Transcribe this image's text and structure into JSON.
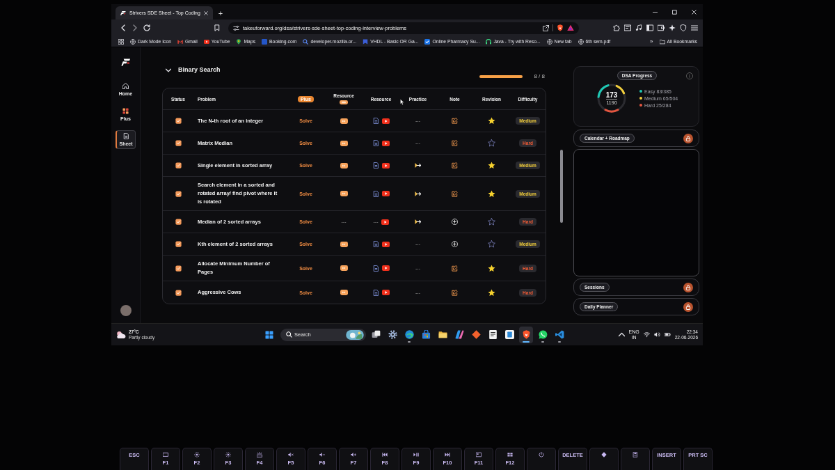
{
  "browser": {
    "tab": {
      "title": "Strivers SDE Sheet - Top Coding"
    },
    "new_tab": "+",
    "url": "takeuforward.org/dsa/strivers-sde-sheet-top-coding-interview-problems",
    "bookmarks": [
      {
        "kind": "globe",
        "label": "Dark Mode Icon"
      },
      {
        "kind": "mail",
        "label": "Gmail"
      },
      {
        "kind": "video",
        "label": "YouTube"
      },
      {
        "kind": "pin",
        "label": "Maps"
      },
      {
        "kind": "square",
        "label": "Booking.com"
      },
      {
        "kind": "magnifier",
        "label": "developer.mozilla.or..."
      },
      {
        "kind": "pentagon",
        "label": "VHDL - Basic OR Ga..."
      },
      {
        "kind": "check",
        "label": "Online Pharmacy Su..."
      },
      {
        "kind": "headphones",
        "label": "Java - Try with Reso..."
      },
      {
        "kind": "globe",
        "label": "New tab"
      },
      {
        "kind": "globe",
        "label": "6th sem.pdf"
      }
    ],
    "more": "»",
    "all_bookmarks": "All Bookmarks"
  },
  "nav": [
    {
      "kind": "home",
      "label": "Home",
      "selected": false
    },
    {
      "kind": "plus",
      "label": "Plus",
      "selected": false
    },
    {
      "kind": "sheet",
      "label": "Sheet",
      "selected": true
    }
  ],
  "section": {
    "title": "Binary Search",
    "expanded": true,
    "level": 1,
    "count": "8 / 8"
  },
  "table": {
    "columns": [
      {
        "kind": "text",
        "label": "Status"
      },
      {
        "kind": "text",
        "label": "Problem"
      },
      {
        "kind": "badge",
        "label": "Plus"
      },
      {
        "kind": "text_badge",
        "label": "Resource"
      },
      {
        "kind": "text",
        "label": "Resource"
      },
      {
        "kind": "text",
        "label": "Practice"
      },
      {
        "kind": "text",
        "label": "Note"
      },
      {
        "kind": "text",
        "label": "Revision"
      },
      {
        "kind": "text",
        "label": "Difficulty"
      }
    ],
    "rows": [
      {
        "checked": true,
        "problem": "The N-th root of an integer",
        "solve": "Solve",
        "plus_resource": {
          "kind": "video_badge"
        },
        "resource": [
          {
            "kind": "article"
          },
          {
            "kind": "video"
          }
        ],
        "practice": {
          "kind": "none",
          "text": "---"
        },
        "note": {
          "kind": "edit"
        },
        "starred": true,
        "difficulty": {
          "kind": "medium",
          "label": "Medium"
        }
      },
      {
        "checked": true,
        "problem": "Matrix Median",
        "solve": "Solve",
        "plus_resource": {
          "kind": "video_badge"
        },
        "resource": [
          {
            "kind": "article"
          },
          {
            "kind": "video"
          }
        ],
        "practice": {
          "kind": "none",
          "text": "---"
        },
        "note": {
          "kind": "edit"
        },
        "starred": false,
        "difficulty": {
          "kind": "hard",
          "label": "Hard"
        }
      },
      {
        "checked": true,
        "problem": "Single element in sorted array",
        "solve": "Solve",
        "plus_resource": {
          "kind": "video_badge"
        },
        "resource": [
          {
            "kind": "article"
          },
          {
            "kind": "video"
          }
        ],
        "practice": {
          "kind": "link"
        },
        "note": {
          "kind": "edit"
        },
        "starred": true,
        "difficulty": {
          "kind": "medium",
          "label": "Medium"
        }
      },
      {
        "checked": true,
        "problem": "Search element in a sorted and rotated array/ find pivot where it is rotated",
        "solve": "Solve",
        "plus_resource": {
          "kind": "video_badge"
        },
        "resource": [
          {
            "kind": "article"
          },
          {
            "kind": "video"
          }
        ],
        "practice": {
          "kind": "link"
        },
        "note": {
          "kind": "edit"
        },
        "starred": true,
        "difficulty": {
          "kind": "medium",
          "label": "Medium"
        }
      },
      {
        "checked": true,
        "problem": "Median of 2 sorted arrays",
        "solve": "Solve",
        "plus_resource": {
          "kind": "none",
          "text": "---"
        },
        "resource": [
          {
            "kind": "none",
            "text": "---"
          },
          {
            "kind": "video"
          }
        ],
        "practice": {
          "kind": "link"
        },
        "note": {
          "kind": "add"
        },
        "starred": false,
        "difficulty": {
          "kind": "hard",
          "label": "Hard"
        }
      },
      {
        "checked": true,
        "problem": "Kth element of 2 sorted arrays",
        "solve": "Solve",
        "plus_resource": {
          "kind": "video_badge"
        },
        "resource": [
          {
            "kind": "article"
          },
          {
            "kind": "video"
          }
        ],
        "practice": {
          "kind": "none",
          "text": "---"
        },
        "note": {
          "kind": "add"
        },
        "starred": false,
        "difficulty": {
          "kind": "medium",
          "label": "Medium"
        }
      },
      {
        "checked": true,
        "problem": "Allocate Minimum Number of Pages",
        "solve": "Solve",
        "plus_resource": {
          "kind": "video_badge"
        },
        "resource": [
          {
            "kind": "article"
          },
          {
            "kind": "video"
          }
        ],
        "practice": {
          "kind": "none",
          "text": "---"
        },
        "note": {
          "kind": "edit"
        },
        "starred": true,
        "difficulty": {
          "kind": "hard",
          "label": "Hard"
        }
      },
      {
        "checked": true,
        "problem": "Aggressive Cows",
        "solve": "Solve",
        "plus_resource": {
          "kind": "video_badge"
        },
        "resource": [
          {
            "kind": "article"
          },
          {
            "kind": "video"
          }
        ],
        "practice": {
          "kind": "none",
          "text": "---"
        },
        "note": {
          "kind": "edit"
        },
        "starred": true,
        "difficulty": {
          "kind": "hard",
          "label": "Hard"
        }
      }
    ]
  },
  "progress": {
    "title": "DSA Progress",
    "solved": "173",
    "total": "1190",
    "legend": [
      {
        "label": "Easy 83/385",
        "color": "#1fc8b4"
      },
      {
        "label": "Medium 65/504",
        "color": "#f2cf3c"
      },
      {
        "label": "Hard 25/284",
        "color": "#e5553f"
      }
    ]
  },
  "calendar": {
    "label": "Calendar + Roadmap",
    "locked": true
  },
  "sessions": {
    "label": "Sessions",
    "locked": true
  },
  "daily_planner": {
    "label": "Daily Planner",
    "locked": true
  },
  "taskbar": {
    "weather": {
      "temp": "27°C",
      "condition": "Partly cloudy"
    },
    "search": {
      "placeholder": "Search"
    },
    "apps": [
      {
        "kind": "task_view",
        "running": false,
        "selected": false
      },
      {
        "kind": "settings",
        "running": false,
        "selected": false
      },
      {
        "kind": "browser",
        "running": true,
        "selected": false
      },
      {
        "kind": "store",
        "running": false,
        "selected": false
      },
      {
        "kind": "files",
        "running": false,
        "selected": false
      },
      {
        "kind": "assistant",
        "running": false,
        "selected": false
      },
      {
        "kind": "diamond",
        "running": false,
        "selected": false
      },
      {
        "kind": "document",
        "running": false,
        "selected": false
      },
      {
        "kind": "square",
        "running": false,
        "selected": false
      },
      {
        "kind": "shield",
        "running": true,
        "selected": true
      },
      {
        "kind": "chat",
        "running": true,
        "selected": false
      },
      {
        "kind": "code",
        "running": true,
        "selected": false
      }
    ],
    "language": "ENG",
    "region": "IN",
    "time": "22:34",
    "date": "22-06-2026"
  },
  "keyboard": {
    "keys": [
      {
        "label": "ESC"
      },
      {
        "kind": "display",
        "label": "F1"
      },
      {
        "kind": "sun_small",
        "label": "F2"
      },
      {
        "kind": "sun_large",
        "label": "F3"
      },
      {
        "kind": "backlight",
        "label": "F4"
      },
      {
        "kind": "mute",
        "label": "F5"
      },
      {
        "kind": "volume_down",
        "label": "F6"
      },
      {
        "kind": "volume_up",
        "label": "F7"
      },
      {
        "kind": "previous",
        "label": "F8"
      },
      {
        "kind": "play_pause",
        "label": "F9"
      },
      {
        "kind": "next",
        "label": "F10"
      },
      {
        "kind": "window",
        "label": "F11"
      },
      {
        "kind": "grid",
        "label": "F12"
      },
      {
        "kind": "power"
      },
      {
        "label": "DELETE"
      },
      {
        "kind": "diamond"
      },
      {
        "kind": "calculator"
      },
      {
        "label": "INSERT"
      },
      {
        "label": "PRT SC"
      }
    ]
  }
}
